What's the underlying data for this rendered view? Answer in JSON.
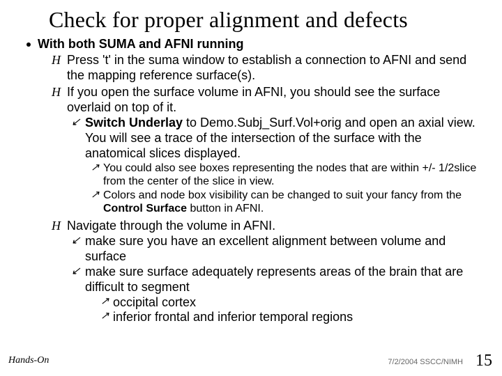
{
  "title": "Check for proper alignment and defects",
  "b0": "With both SUMA and AFNI running",
  "b1a": "Press 't' in the suma window to establish a connection to AFNI and send the mapping reference surface(s).",
  "b1b": "If you open the surface volume in AFNI, you should see the surface overlaid on top of it.",
  "b2a_pre": "Switch Underlay",
  "b2a_post": " to Demo.Subj_Surf.Vol+orig and open an axial view. You will see a trace of the intersection of the surface with the anatomical slices displayed.",
  "b3a": "You could also see boxes representing the nodes that are within +/- 1/2slice from the center of the slice in view.",
  "b3b_pre": "Colors and node box visibility can be changed to suit your fancy from the ",
  "b3b_bold": "Control Surface",
  "b3b_post": " button in AFNI.",
  "b1c": "Navigate through the volume in AFNI.",
  "b2b": "make sure you have an excellent alignment between volume and surface",
  "b2c": "make sure surface adequately represents areas of the brain that are difficult to segment",
  "b4a": "occipital cortex",
  "b4b": "inferior frontal and inferior temporal regions",
  "footer_left": "Hands-On",
  "footer_right": "7/2/2004 SSCC/NIMH",
  "page": "15",
  "glyph_h": "H",
  "glyph_arrow": "↙",
  "glyph_arrow2": "↗"
}
